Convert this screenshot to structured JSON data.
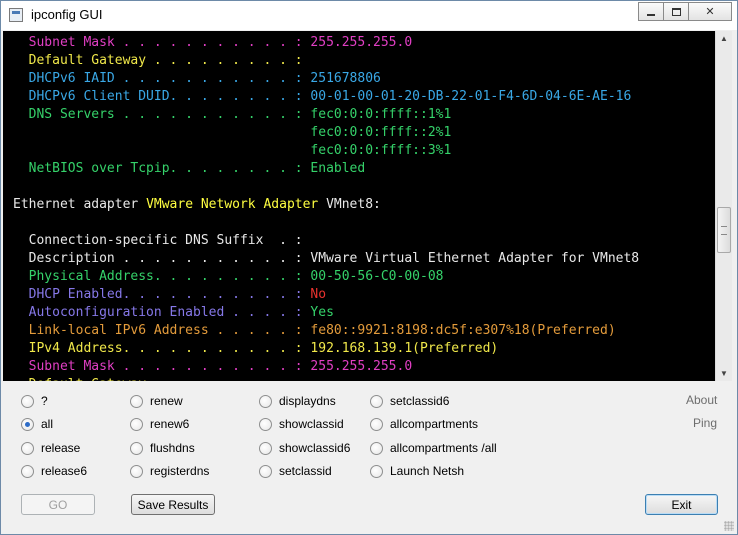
{
  "window": {
    "title": "ipconfig GUI"
  },
  "colors": {
    "magenta": "#e13fc4",
    "yellow": "#f0e84a",
    "cyan": "#3aa8e6",
    "green": "#35d26a",
    "white": "#e8e8e8",
    "purple": "#8678e8",
    "red": "#e8322e",
    "orange": "#e39b3b",
    "bright_yellow": "#ffff40"
  },
  "console_lines": [
    [
      {
        "t": "  Subnet Mask . . . . . . . . . . . : 255.255.255.0",
        "c": "magenta"
      }
    ],
    [
      {
        "t": "  Default Gateway . . . . . . . . . :",
        "c": "yellow"
      }
    ],
    [
      {
        "t": "  DHCPv6 IAID . . . . . . . . . . . : 251678806",
        "c": "cyan"
      }
    ],
    [
      {
        "t": "  DHCPv6 Client DUID. . . . . . . . : 00-01-00-01-20-DB-22-01-F4-6D-04-6E-AE-16",
        "c": "cyan"
      }
    ],
    [
      {
        "t": "  DNS Servers . . . . . . . . . . . : fec0:0:0:ffff::1%1",
        "c": "green"
      }
    ],
    [
      {
        "t": "                                      fec0:0:0:ffff::2%1",
        "c": "green"
      }
    ],
    [
      {
        "t": "                                      fec0:0:0:ffff::3%1",
        "c": "green"
      }
    ],
    [
      {
        "t": "  NetBIOS over Tcpip. . . . . . . . : Enabled",
        "c": "green"
      }
    ],
    [
      {
        "t": "",
        "c": "white"
      }
    ],
    [
      {
        "t": "Ethernet adapter ",
        "c": "white"
      },
      {
        "t": "VMware Network Adapter",
        "c": "bright_yellow"
      },
      {
        "t": " VMnet8:",
        "c": "white"
      }
    ],
    [
      {
        "t": "",
        "c": "white"
      }
    ],
    [
      {
        "t": "  Connection-specific DNS Suffix  . :",
        "c": "white"
      }
    ],
    [
      {
        "t": "  Description . . . . . . . . . . . : VMware Virtual Ethernet Adapter for VMnet8",
        "c": "white"
      }
    ],
    [
      {
        "t": "  Physical Address. . . . . . . . . : 00-50-56-C0-00-08",
        "c": "green"
      }
    ],
    [
      {
        "t": "  DHCP Enabled. . . . . . . . . . . : ",
        "c": "purple"
      },
      {
        "t": "No",
        "c": "red"
      }
    ],
    [
      {
        "t": "  Autoconfiguration Enabled . . . . : ",
        "c": "purple"
      },
      {
        "t": "Yes",
        "c": "green"
      }
    ],
    [
      {
        "t": "  Link-local IPv6 Address . . . . . : fe80::9921:8198:dc5f:e307%18(Preferred)",
        "c": "orange"
      }
    ],
    [
      {
        "t": "  IPv4 Address. . . . . . . . . . . : 192.168.139.1(Preferred)",
        "c": "yellow"
      }
    ],
    [
      {
        "t": "  Subnet Mask . . . . . . . . . . . : 255.255.255.0",
        "c": "magenta"
      }
    ],
    [
      {
        "t": "  Default Gateway . . . . . . . . . :",
        "c": "yellow"
      }
    ]
  ],
  "options": {
    "col1": [
      "?",
      "all",
      "release",
      "release6"
    ],
    "col2": [
      "renew",
      "renew6",
      "flushdns",
      "registerdns"
    ],
    "col3": [
      "displaydns",
      "showclassid",
      "showclassid6",
      "setclassid"
    ],
    "col4": [
      "setclassid6",
      "allcompartments",
      "allcompartments /all",
      "Launch Netsh"
    ],
    "selected": "all"
  },
  "links": {
    "about": "About",
    "ping": "Ping"
  },
  "buttons": {
    "go": "GO",
    "save": "Save Results",
    "exit": "Exit"
  }
}
